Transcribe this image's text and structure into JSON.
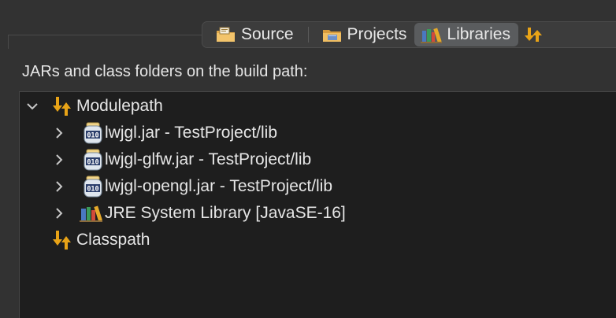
{
  "tabs": [
    {
      "label": "Source",
      "icon": "source-folder-icon",
      "selected": false
    },
    {
      "label": "Projects",
      "icon": "projects-folder-icon",
      "selected": false
    },
    {
      "label": "Libraries",
      "icon": "libraries-books-icon",
      "selected": true
    }
  ],
  "heading": "JARs and class folders on the build path:",
  "tree": {
    "modulepath": {
      "label": "Modulepath",
      "expanded": true,
      "children": [
        {
          "label": "lwjgl.jar - TestProject/lib",
          "icon": "jar-icon"
        },
        {
          "label": "lwjgl-glfw.jar - TestProject/lib",
          "icon": "jar-icon"
        },
        {
          "label": "lwjgl-opengl.jar - TestProject/lib",
          "icon": "jar-icon"
        },
        {
          "label": "JRE System Library [JavaSE-16]",
          "icon": "library-books-icon"
        }
      ]
    },
    "classpath": {
      "label": "Classpath",
      "expanded": false
    }
  },
  "colors": {
    "background": "#323232",
    "tree_background": "#1e1e1e",
    "selected_tab": "#5a5c5e",
    "text": "#e6e6e6",
    "arrow_icon": "#e8a317"
  }
}
